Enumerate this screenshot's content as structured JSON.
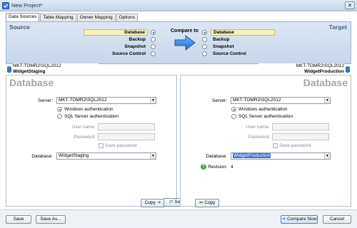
{
  "window": {
    "title": "New Project*"
  },
  "tabs": [
    "Data Sources",
    "Table Mapping",
    "Owner Mapping",
    "Options"
  ],
  "band": {
    "source_title": "Source",
    "target_title": "Target",
    "compare_to": "Compare to",
    "source_options": [
      "Database",
      "Backup",
      "Snapshot",
      "Source Control"
    ],
    "target_options": [
      "Database",
      "Backup",
      "Snapshot",
      "Source Control"
    ]
  },
  "source": {
    "server_line": "MKT-TOMR2\\SQL2012",
    "database_line": "WidgetStaging",
    "heading": "Database",
    "server_label": "Server:",
    "server_value": "MKT-TOMR2\\SQL2012",
    "auth_windows": "Windows authentication",
    "auth_sql": "SQL Server authentication",
    "username_label": "User name:",
    "password_label": "Password:",
    "save_password": "Save password",
    "database_label": "Database:",
    "database_value": "WidgetStaging"
  },
  "target": {
    "server_line": "MKT-TOMR2\\SQL2012",
    "database_line": "WidgetProduction",
    "heading": "Database",
    "server_label": "Server:",
    "server_value": "MKT-TOMR2\\SQL2012",
    "auth_windows": "Windows authentication",
    "auth_sql": "SQL Server authentication",
    "username_label": "User name:",
    "password_label": "Password:",
    "save_password": "Save password",
    "database_label": "Database:",
    "database_value": "WidgetProduction",
    "revision_label": "Revision:",
    "revision_value": "4"
  },
  "middle_buttons": {
    "copy_right": "Copy",
    "switch": "Switch",
    "copy_left": "Copy"
  },
  "footer": {
    "save": "Save",
    "save_as": "Save As...",
    "compare_now": "Compare Now",
    "cancel": "Cancel"
  },
  "colors": {
    "band_bg": "#dce6f3",
    "selected_option_bg": "#f5f1b8",
    "arrow": "#2f7fd9",
    "selection": "#3b6fd1"
  }
}
